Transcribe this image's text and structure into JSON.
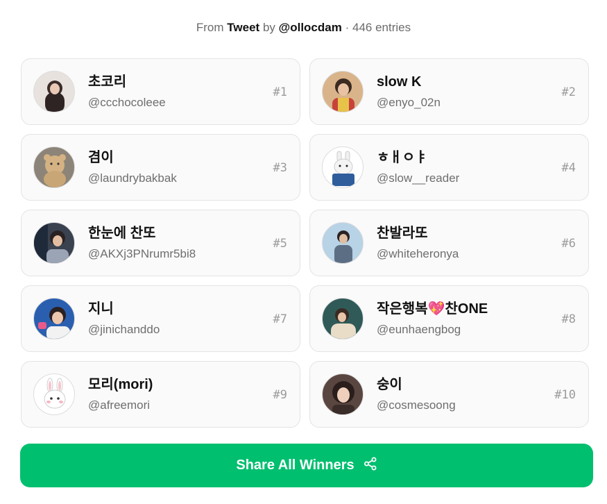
{
  "source": {
    "prefix": "From",
    "platform": "Tweet",
    "by": "by",
    "author": "@ollocdam",
    "separator": "·",
    "entries": "446 entries"
  },
  "winners": [
    {
      "name": "초코리",
      "handle": "@ccchocoleee",
      "rank": "#1",
      "avatar_color": "#4a3a3a"
    },
    {
      "name": "slow K",
      "handle": "@enyo_02n",
      "rank": "#2",
      "avatar_color": "#b07a55"
    },
    {
      "name": "겸이",
      "handle": "@laundrybakbak",
      "rank": "#3",
      "avatar_color": "#9a8a70"
    },
    {
      "name": "ㅎㅐㅇㅑ",
      "handle": "@slow__reader",
      "rank": "#4",
      "avatar_color": "#ffffff"
    },
    {
      "name": "한눈에 찬또",
      "handle": "@AKXj3PNrumr5bi8",
      "rank": "#5",
      "avatar_color": "#3a4250"
    },
    {
      "name": "찬발라또",
      "handle": "@whiteheronya",
      "rank": "#6",
      "avatar_color": "#b8d2e6"
    },
    {
      "name": "지니",
      "handle": "@jinichanddo",
      "rank": "#7",
      "avatar_color": "#2a5fb0"
    },
    {
      "name": "작은행복💖찬ONE",
      "handle": "@eunhaengbog",
      "rank": "#8",
      "avatar_color": "#2f5a58"
    },
    {
      "name": "모리(mori)",
      "handle": "@afreemori",
      "rank": "#9",
      "avatar_color": "#ffffff"
    },
    {
      "name": "숭이",
      "handle": "@cosmesoong",
      "rank": "#10",
      "avatar_color": "#5a4640"
    }
  ],
  "share_button": {
    "label": "Share All Winners",
    "icon": "share-icon",
    "color": "#00bf6f"
  }
}
